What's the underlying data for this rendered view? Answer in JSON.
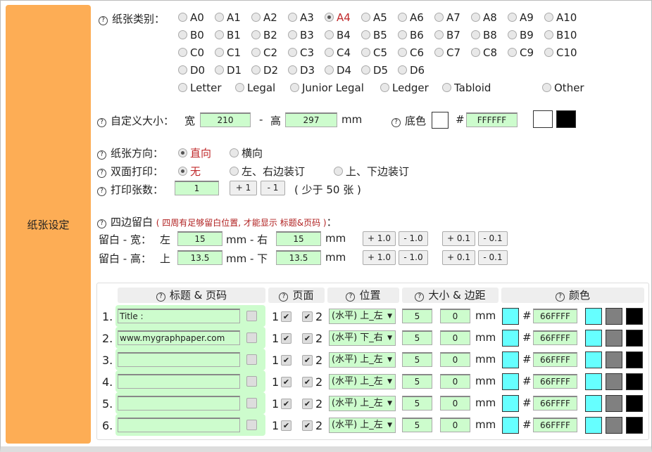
{
  "side_label": "纸张设定",
  "paper_type": {
    "label": "纸张类别：",
    "selected": "A4",
    "rows": [
      [
        "A0",
        "A1",
        "A2",
        "A3",
        "A4",
        "A5",
        "A6",
        "A7",
        "A8",
        "A9",
        "A10"
      ],
      [
        "B0",
        "B1",
        "B2",
        "B3",
        "B4",
        "B5",
        "B6",
        "B7",
        "B8",
        "B9",
        "B10"
      ],
      [
        "C0",
        "C1",
        "C2",
        "C3",
        "C4",
        "C5",
        "C6",
        "C7",
        "C8",
        "C9",
        "C10"
      ],
      [
        "D0",
        "D1",
        "D2",
        "D3",
        "D4",
        "D5",
        "D6"
      ]
    ],
    "special": [
      "Letter",
      "Legal",
      "Junior Legal",
      "Ledger",
      "Tabloid",
      "Other"
    ]
  },
  "custom_size": {
    "label": "自定义大小：",
    "width_label": "宽",
    "width": "210",
    "sep": "-",
    "height_label": "高",
    "height": "297",
    "unit": "mm"
  },
  "bg_color": {
    "label": "底色",
    "hash": "#",
    "value": "FFFFFF",
    "swatch": "#FFFFFF"
  },
  "orientation": {
    "label": "纸张方向：",
    "options": [
      "直向",
      "横向"
    ],
    "selected": 0
  },
  "duplex": {
    "label": "双面打印：",
    "options": [
      "无",
      "左、右边装订",
      "上、下边装订"
    ],
    "selected": 0
  },
  "copies": {
    "label": "打印张数：",
    "value": "1",
    "plus": "+ 1",
    "minus": "- 1",
    "note": "( 少于 50 张 )"
  },
  "margins": {
    "label": "四边留白",
    "note": "( 四周有足够留白位置, 才能显示 标题&页码 )",
    "colon": "：",
    "w_label": "留白 - 宽：",
    "left_label": "左",
    "left": "15",
    "mid_w": "mm - 右",
    "right": "15",
    "h_label": "留白 - 高：",
    "top_label": "上",
    "top": "13.5",
    "mid_h": "mm - 下",
    "bottom": "13.5",
    "unit": "mm",
    "b1p": "+ 1.0",
    "b1m": "- 1.0",
    "b01p": "+ 0.1",
    "b01m": "- 0.1"
  },
  "table": {
    "headers": [
      "标题 & 页码",
      "页面",
      "位置",
      "大小 & 边距",
      "颜色"
    ],
    "rows": [
      {
        "n": "1.",
        "text": "Title :",
        "pos": "(水平) 上_左",
        "size": "5",
        "margin": "0",
        "color": "66FFFF"
      },
      {
        "n": "2.",
        "text": "www.mygraphpaper.com",
        "pos": "(水平) 下_右",
        "size": "5",
        "margin": "0",
        "color": "66FFFF"
      },
      {
        "n": "3.",
        "text": "",
        "pos": "(水平) 上_左",
        "size": "5",
        "margin": "0",
        "color": "66FFFF"
      },
      {
        "n": "4.",
        "text": "",
        "pos": "(水平) 上_左",
        "size": "5",
        "margin": "0",
        "color": "66FFFF"
      },
      {
        "n": "5.",
        "text": "",
        "pos": "(水平) 上_左",
        "size": "5",
        "margin": "0",
        "color": "66FFFF"
      },
      {
        "n": "6.",
        "text": "",
        "pos": "(水平) 上_左",
        "size": "5",
        "margin": "0",
        "color": "66FFFF"
      }
    ],
    "page1": "1",
    "page2": "2",
    "unit": "mm",
    "hash": "#"
  },
  "colors": {
    "accent": "#FDAD55",
    "input_bg": "#CDFCCD",
    "cyan": "#66FFFF",
    "gray": "#808080",
    "black": "#000000"
  }
}
